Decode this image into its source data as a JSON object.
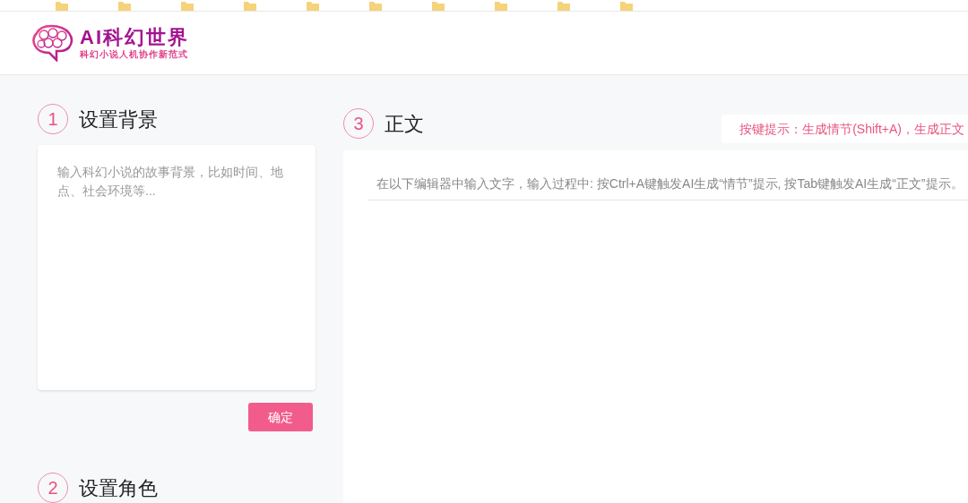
{
  "header": {
    "logo_title": "AI科幻世界",
    "logo_subtitle": "科幻小说人机协作新范式"
  },
  "sections": [
    {
      "number": "1",
      "title": "设置背景",
      "placeholder": "输入科幻小说的故事背景，比如时间、地点、社会环境等...",
      "button": "确定"
    },
    {
      "number": "2",
      "title": "设置角色"
    }
  ],
  "main": {
    "number": "3",
    "title": "正文",
    "hint": "按键提示：生成情节(Shift+A)，生成正文",
    "editor_placeholder": "在以下编辑器中输入文字，输入过程中: 按Ctrl+A键触发AI生成“情节”提示, 按Tab键触发AI生成“正文”提示。"
  }
}
